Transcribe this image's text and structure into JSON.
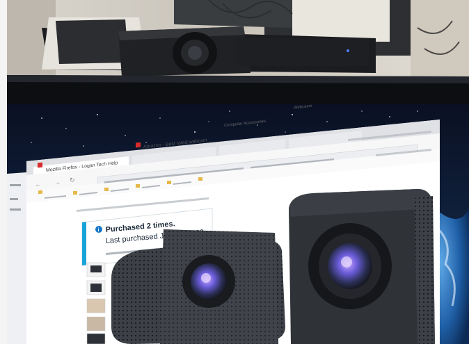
{
  "photo": {
    "banner": {
      "title": "Purchased 2 times.",
      "subtitle": "Last purchased Jan 14, 2023."
    },
    "tabs": [
      {
        "label": "Mozilla Firefox - Logan Tech Help"
      },
      {
        "label": "Amazon - Best rated webcam"
      },
      {
        "label": "Computer Accessories"
      },
      {
        "label": "Webcams"
      }
    ],
    "colors": {
      "banner_accent": "#1aa3d9",
      "info_icon": "#1677c9",
      "bezel": "#0c0e12",
      "screen_sky": "#0b1a33"
    }
  }
}
